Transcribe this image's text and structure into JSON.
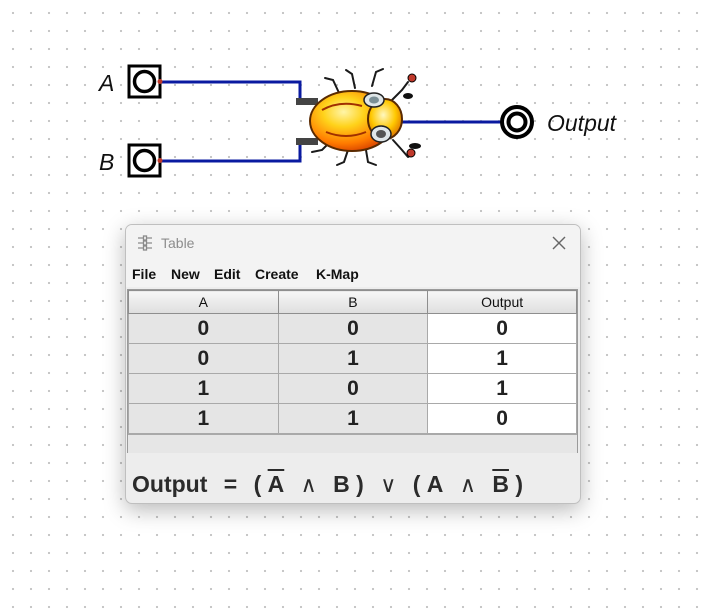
{
  "circuit": {
    "input_a_label": "A",
    "input_b_label": "B",
    "output_label": "Output",
    "wire_color": "#0a1aa0",
    "gate_icon": "bug-icon"
  },
  "window": {
    "title": "Table",
    "close_icon": "close-icon",
    "menu": [
      "File",
      "New",
      "Edit",
      "Create",
      "K-Map"
    ]
  },
  "truth_table": {
    "headers": [
      "A",
      "B",
      "Output"
    ],
    "rows": [
      [
        "0",
        "0",
        "0"
      ],
      [
        "0",
        "1",
        "1"
      ],
      [
        "1",
        "0",
        "1"
      ],
      [
        "1",
        "1",
        "0"
      ]
    ]
  },
  "expression": {
    "lhs": "Output",
    "eq": "=",
    "open1": "(",
    "a1": "A",
    "and1": "∧",
    "b1": "B",
    "close1": ")",
    "or": "∨",
    "open2": "(",
    "a2": "A",
    "and2": "∧",
    "b2": "B",
    "close2": ")"
  }
}
